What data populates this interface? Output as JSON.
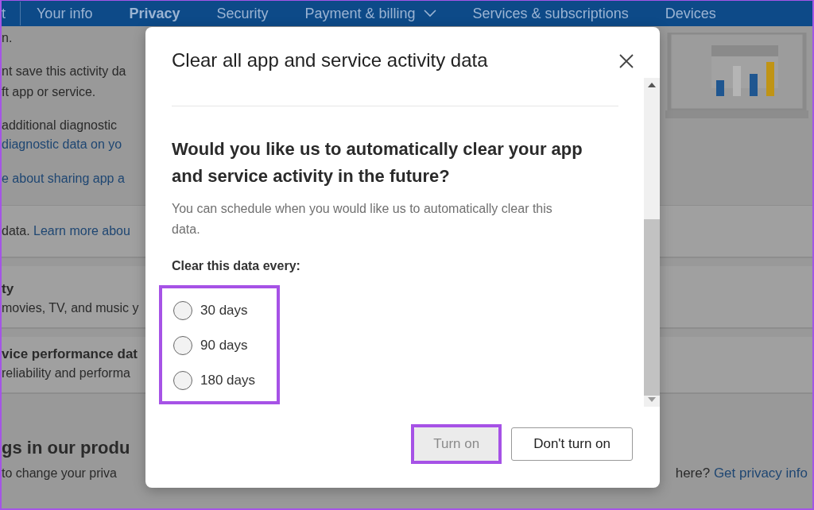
{
  "nav": {
    "items": [
      {
        "label": "t",
        "selected": false,
        "dropdown": false
      },
      {
        "label": "Your info",
        "selected": false,
        "dropdown": false
      },
      {
        "label": "Privacy",
        "selected": true,
        "dropdown": false
      },
      {
        "label": "Security",
        "selected": false,
        "dropdown": false
      },
      {
        "label": "Payment & billing",
        "selected": false,
        "dropdown": true
      },
      {
        "label": "Services & subscriptions",
        "selected": false,
        "dropdown": false
      },
      {
        "label": "Devices",
        "selected": false,
        "dropdown": false
      }
    ]
  },
  "background": {
    "sections": [
      {
        "kind": "plain",
        "lines": [
          [
            {
              "kind": "text",
              "text": "n."
            }
          ]
        ]
      },
      {
        "kind": "plain",
        "lines": [
          [
            {
              "kind": "text",
              "text": "nt save this activity da"
            }
          ],
          [
            {
              "kind": "text",
              "text": "ft app or service."
            }
          ]
        ]
      },
      {
        "kind": "plain",
        "lines": [
          [
            {
              "kind": "text",
              "text": "additional diagnostic"
            }
          ],
          [
            {
              "kind": "link",
              "text": "diagnostic data on yo"
            }
          ]
        ]
      },
      {
        "kind": "plain",
        "lines": [
          [
            {
              "kind": "link",
              "text": "e about sharing app a"
            }
          ]
        ]
      },
      {
        "kind": "card",
        "lines": [
          [
            {
              "kind": "text",
              "text": "data. "
            },
            {
              "kind": "link",
              "text": "Learn more abou"
            }
          ]
        ]
      },
      {
        "kind": "card",
        "lines": [
          [
            {
              "kind": "title",
              "text": "ty"
            }
          ],
          [
            {
              "kind": "text",
              "text": "movies, TV, and music y"
            }
          ]
        ]
      },
      {
        "kind": "card",
        "lines": [
          [
            {
              "kind": "title",
              "text": "vice performance dat"
            }
          ],
          [
            {
              "kind": "text",
              "text": "reliability and performa"
            }
          ]
        ]
      },
      {
        "kind": "footer",
        "lines": [
          [
            {
              "kind": "heading",
              "text": "gs in our produ"
            }
          ],
          [
            {
              "kind": "text",
              "text": "to change your priva"
            }
          ]
        ]
      }
    ],
    "footer_right": [
      {
        "kind": "text",
        "text": "here? "
      },
      {
        "kind": "link",
        "text": "Get privacy info"
      }
    ]
  },
  "dialog": {
    "title": "Clear all app and service activity data",
    "question": "Would you like us to automatically clear your app and service activity in the future?",
    "description": "You can schedule when you would like us to automatically clear this data.",
    "group_label": "Clear this data every:",
    "options_highlighted": true,
    "options": [
      {
        "label": "30 days",
        "selected": false
      },
      {
        "label": "90 days",
        "selected": false
      },
      {
        "label": "180 days",
        "selected": false
      }
    ],
    "buttons": [
      {
        "label": "Turn on",
        "kind": "primary",
        "disabled": true,
        "highlighted": true
      },
      {
        "label": "Don't turn on",
        "kind": "secondary",
        "disabled": false,
        "highlighted": false
      }
    ]
  }
}
